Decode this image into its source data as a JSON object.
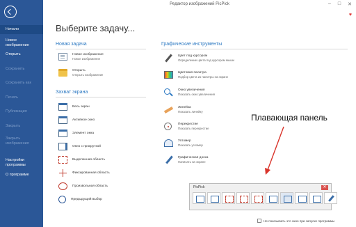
{
  "window": {
    "title": "Редактор изображений PicPick",
    "controls": [
      "–",
      "□",
      "✕"
    ]
  },
  "sidebar": {
    "items": [
      {
        "label": "Начало",
        "active": true
      },
      {
        "label": "Новое\nизображение"
      },
      {
        "label": "Открыть"
      },
      {
        "label": "Сохранить",
        "dim": true
      },
      {
        "label": "Сохранить как",
        "dim": true
      },
      {
        "label": "Печать",
        "dim": true
      },
      {
        "label": "Публикация",
        "dim": true
      },
      {
        "label": "Закрыть",
        "dim": true
      },
      {
        "label": "Закрыть\nизображения",
        "dim": true
      },
      {
        "label": "Настройки\nпрограммы"
      },
      {
        "label": "О программе"
      }
    ]
  },
  "main": {
    "heading": "Выберите задачу...",
    "new_task": {
      "title": "Новая задача",
      "items": [
        {
          "label": "Новое изображение",
          "sub": "Новое изображение",
          "icon": "new-image-icon"
        },
        {
          "label": "Открыть",
          "sub": "Открыть изображение",
          "icon": "open-folder-icon"
        }
      ]
    },
    "capture": {
      "title": "Захват экрана",
      "items": [
        {
          "label": "Весь экран",
          "icon": "fullscreen-icon"
        },
        {
          "label": "Активное окно",
          "icon": "active-window-icon"
        },
        {
          "label": "Элемент окна",
          "icon": "window-element-icon"
        },
        {
          "label": "Окно с прокруткой",
          "icon": "scroll-window-icon"
        },
        {
          "label": "Выделенная область",
          "icon": "region-icon"
        },
        {
          "label": "Фиксированная область",
          "icon": "fixed-region-icon"
        },
        {
          "label": "Произвольная область",
          "icon": "freehand-icon"
        },
        {
          "label": "Предыдущий выбор",
          "icon": "repeat-icon"
        }
      ]
    },
    "graphics": {
      "title": "Графические инструменты",
      "items": [
        {
          "label": "Цвет под курсором",
          "sub": "Определение цвета под курсором мыши",
          "icon": "color-picker-icon"
        },
        {
          "label": "Цветовая палитра",
          "sub": "Подбор цвета из палитры на экране",
          "icon": "palette-icon"
        },
        {
          "label": "Окно увеличения",
          "sub": "Показать окно увеличения",
          "icon": "magnifier-icon"
        },
        {
          "label": "Линейка",
          "sub": "Показать линейку",
          "icon": "ruler-icon"
        },
        {
          "label": "Перекрестие",
          "sub": "Показать перекрестие",
          "icon": "crosshair-icon"
        },
        {
          "label": "Угломер",
          "sub": "Показать угломер",
          "icon": "protractor-icon"
        },
        {
          "label": "Графическая доска",
          "sub": "Написать на экране",
          "icon": "whiteboard-icon"
        }
      ]
    }
  },
  "annotation": {
    "label": "Плавающая панель",
    "color": "#d9342b"
  },
  "floating_panel": {
    "title": "PicPick",
    "close": "✕"
  },
  "footer": {
    "checkbox_label": "Не показывать это окно при запуске программы"
  },
  "colors": {
    "sidebar": "#2b5797",
    "accent": "#2b78c2",
    "heart": "#e03b3b"
  }
}
